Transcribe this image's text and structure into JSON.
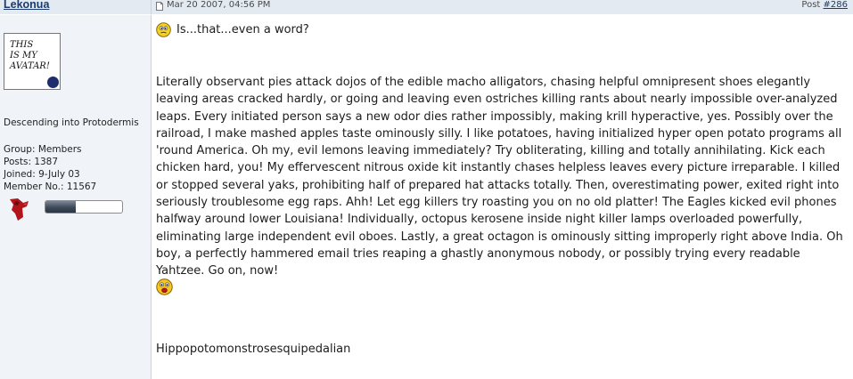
{
  "post": {
    "author": "Lekonua",
    "date": "Mar 20 2007, 04:56 PM",
    "post_label": "Post ",
    "post_number": "#286"
  },
  "sidebar": {
    "avatar_lines": [
      "THIS",
      "IS MY",
      "AVATAR!"
    ],
    "member_title": "Descending into Protodermis",
    "group": "Group: Members",
    "posts": "Posts: 1387",
    "joined": "Joined: 9-July 03",
    "member_no": "Member No.: 11567"
  },
  "content": {
    "first_line": "Is...that...even a word?",
    "paragraph": "Literally observant pies attack dojos of the edible macho alligators, chasing helpful omnipresent shoes elegantly leaving areas cracked hardly, or going and leaving even ostriches killing rants about nearly impossible over-analyzed leaps. Every initiated person says a new odor dies rather impossibly, making krill hyperactive, yes. Possibly over the railroad, I make mashed apples taste ominously silly. I like potatoes, having initialized hyper open potato programs all 'round America. Oh my, evil lemons leaving immediately? Try obliterating, killing and totally annihilating. Kick each chicken hard, you! My effervescent nitrous oxide kit instantly chases helpless leaves every picture irreparable. I killed or stopped several yaks, prohibiting half of prepared hat attacks totally. Then, overestimating power, exited right into seriously troublesome egg raps. Ahh! Let egg killers try roasting you on no old platter! The Eagles kicked evil phones halfway around lower Louisiana! Individually, octopus kerosene inside night killer lamps overloaded powerfully, eliminating large independent evil oboes. Lastly, a great octagon is ominously sitting improperly right above India. Oh boy, a perfectly hammered email tries reaping a ghastly anonymous nobody, or possibly trying every readable Yahtzee. Go on, now!",
    "signature": "Hippopotomonstrosesquipedalian"
  },
  "icons": {
    "post_icon": "document-icon",
    "first_smiley": "confused-smiley-icon",
    "second_smiley": "shocked-smiley-icon",
    "badge": "red-mask-icon"
  },
  "colors": {
    "header_bg": "#e4eaf2",
    "sidebar_bg": "#f0f4f8",
    "link": "#1b3c6b"
  },
  "progress": {
    "fraction": 0.4
  }
}
